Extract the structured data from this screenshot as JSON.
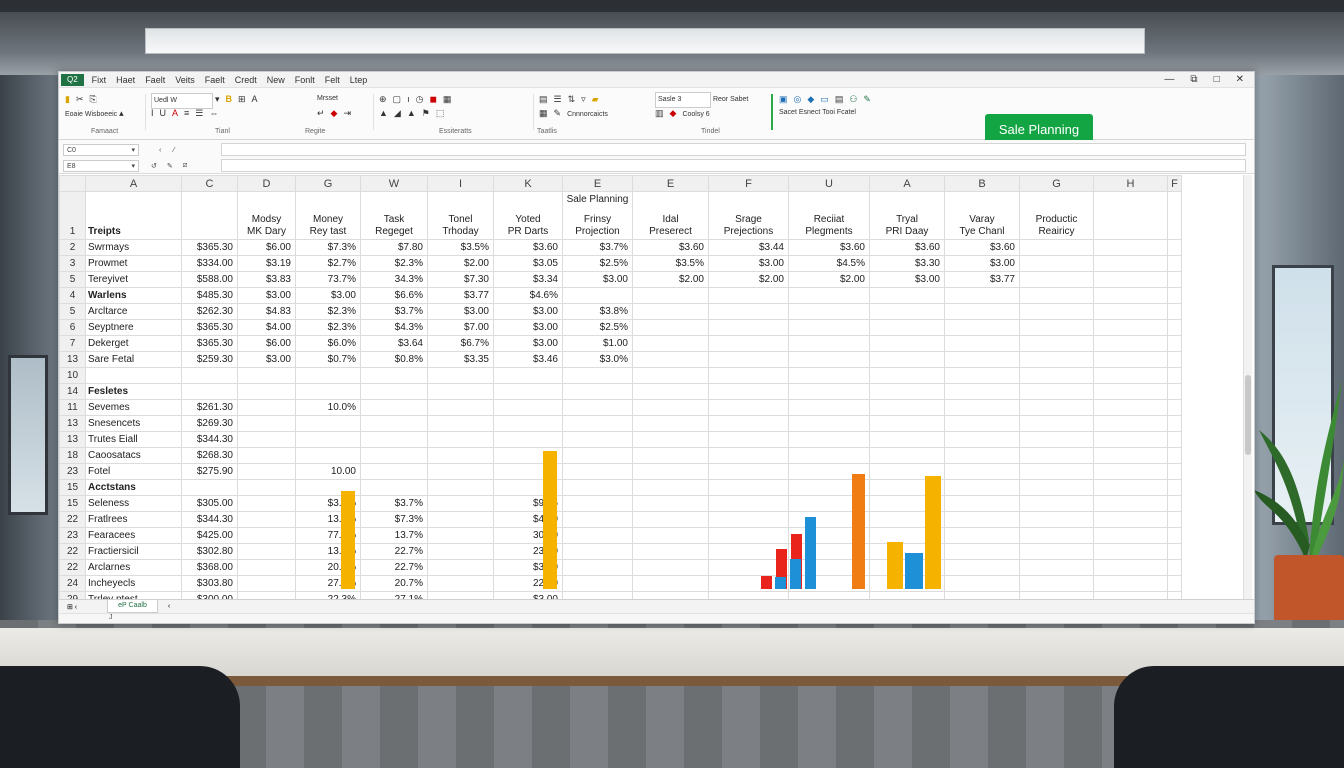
{
  "window": {
    "app_badge": "Q2",
    "menu": [
      "Fixt",
      "Haet",
      "Faelt",
      "Veits",
      "Faelt",
      "Credt",
      "New",
      "Fonlt",
      "Felt",
      "Ltep"
    ],
    "controls": [
      "—",
      "⧉",
      "□",
      "✕"
    ]
  },
  "ribbon": {
    "font_name": "Uedl W",
    "font_size": "Mrsset",
    "style_box": "Sasle 3",
    "group_labels": [
      "Famaact",
      "Tianl",
      "Regite",
      "Essiteratts",
      "Taatlis",
      "Tindel"
    ],
    "item_texts": [
      "Eoaie",
      "Wisboeeic",
      "Cnnnorcaicts",
      "Reor Sabet",
      "Coolsy 6",
      "Sacet",
      "Esnect",
      "Tooi",
      "Fcatel"
    ],
    "sale_button": "Sale Planning"
  },
  "formula_bar": {
    "name_box_1": "C0",
    "name_box_2": "E8"
  },
  "grid": {
    "columns": [
      "A",
      "C",
      "D",
      "G",
      "W",
      "I",
      "K",
      "E",
      "E",
      "F",
      "U",
      "A",
      "B",
      "G",
      "H",
      "F"
    ],
    "sheet_title": "Sale Planning",
    "headers": [
      "Treipts",
      "",
      "Modsy\nMK Dary",
      "Money\nRey tast",
      "Task\nRegeget",
      "Tonel\nTrhoday",
      "Yoted\nPR Darts",
      "Frinsy\nProjection",
      "Idal\nPreserect",
      "Srage\nPrejections",
      "Reciiat\nPlegments",
      "Tryal\nPRI Daay",
      "Varay\nTye Chanl",
      "Productic\nReairicy"
    ],
    "rows": [
      {
        "n": "2",
        "label": "Swrmays",
        "cells": [
          "$365.30",
          "$6.00",
          "$7.3%",
          "$7.80",
          "$3.5%",
          "$3.60",
          "$3.7%",
          "$3.60",
          "$3.44",
          "$3.60",
          "$3.60",
          "$3.60",
          ""
        ]
      },
      {
        "n": "3",
        "label": "Prowmet",
        "cells": [
          "$334.00",
          "$3.19",
          "$2.7%",
          "$2.3%",
          "$2.00",
          "$3.05",
          "$2.5%",
          "$3.5%",
          "$3.00",
          "$4.5%",
          "$3.30",
          "$3.00",
          ""
        ]
      },
      {
        "n": "5",
        "label": "Tereyivet",
        "cells": [
          "$588.00",
          "$3.83",
          "73.7%",
          "34.3%",
          "$7.30",
          "$3.34",
          "$3.00",
          "$2.00",
          "$2.00",
          "$2.00",
          "$3.00",
          "$3.77",
          ""
        ]
      },
      {
        "n": "4",
        "label": "Warlens",
        "section": true,
        "cells": [
          "$485.30",
          "$3.00",
          "$3.00",
          "$6.6%",
          "$3.77",
          "$4.6%",
          "",
          "",
          "",
          "",
          "",
          "",
          ""
        ]
      },
      {
        "n": "5",
        "label": "Arcltarce",
        "cells": [
          "$262.30",
          "$4.83",
          "$2.3%",
          "$3.7%",
          "$3.00",
          "$3.00",
          "$3.8%",
          "",
          "",
          "",
          "",
          "",
          ""
        ]
      },
      {
        "n": "6",
        "label": "Seyptnere",
        "cells": [
          "$365.30",
          "$4.00",
          "$2.3%",
          "$4.3%",
          "$7.00",
          "$3.00",
          "$2.5%",
          "",
          "",
          "",
          "",
          "",
          ""
        ]
      },
      {
        "n": "7",
        "label": "Dekerget",
        "cells": [
          "$365.30",
          "$6.00",
          "$6.0%",
          "$3.64",
          "$6.7%",
          "$3.00",
          "$1.00",
          "",
          "",
          "",
          "",
          "",
          ""
        ]
      },
      {
        "n": "13",
        "label": "Sare Fetal",
        "cells": [
          "$259.30",
          "$3.00",
          "$0.7%",
          "$0.8%",
          "$3.35",
          "$3.46",
          "$3.0%",
          "",
          "",
          "",
          "",
          "",
          ""
        ]
      },
      {
        "n": "10",
        "label": "",
        "cells": [
          "",
          "",
          "",
          "",
          "",
          "",
          "",
          "",
          "",
          "",
          "",
          "",
          ""
        ]
      },
      {
        "n": "14",
        "label": "Fesletes",
        "section": true,
        "cells": [
          "",
          "",
          "",
          "",
          "",
          "",
          "",
          "",
          "",
          "",
          "",
          "",
          ""
        ]
      },
      {
        "n": "11",
        "label": "Sevemes",
        "cells": [
          "$261.30",
          "",
          "10.0%",
          "",
          "",
          "",
          "",
          "",
          "",
          "",
          "",
          "",
          ""
        ]
      },
      {
        "n": "13",
        "label": "Snesencets",
        "cells": [
          "$269.30",
          "",
          "",
          "",
          "",
          "",
          "",
          "",
          "",
          "",
          "",
          "",
          ""
        ]
      },
      {
        "n": "13",
        "label": "Trutes Eiall",
        "cells": [
          "$344.30",
          "",
          "",
          "",
          "",
          "",
          "",
          "",
          "",
          "",
          "",
          "",
          ""
        ]
      },
      {
        "n": "18",
        "label": "Caoosatacs",
        "cells": [
          "$268.30",
          "",
          "",
          "",
          "",
          "",
          "",
          "",
          "",
          "",
          "",
          "",
          ""
        ]
      },
      {
        "n": "23",
        "label": "Fotel",
        "cells": [
          "$275.90",
          "",
          "10.00",
          "",
          "",
          "",
          "",
          "",
          "",
          "",
          "",
          "",
          ""
        ]
      },
      {
        "n": "15",
        "label": "Acctstans",
        "section": true,
        "cells": [
          "",
          "",
          "",
          "",
          "",
          "",
          "",
          "",
          "",
          "",
          "",
          "",
          ""
        ]
      },
      {
        "n": "15",
        "label": "Seleness",
        "cells": [
          "$305.00",
          "",
          "$3.7%",
          "$3.7%",
          "",
          "$9.36",
          "",
          "",
          "",
          "",
          "",
          "",
          ""
        ]
      },
      {
        "n": "22",
        "label": "Fratlrees",
        "cells": [
          "$344.30",
          "",
          "13.7%",
          "$7.3%",
          "",
          "$4.00",
          "",
          "",
          "",
          "",
          "",
          "",
          ""
        ]
      },
      {
        "n": "23",
        "label": "Fearacees",
        "cells": [
          "$425.00",
          "",
          "77.3%",
          "13.7%",
          "",
          "30.00",
          "",
          "",
          "",
          "",
          "",
          "",
          ""
        ]
      },
      {
        "n": "22",
        "label": "Fractiersicil",
        "cells": [
          "$302.80",
          "",
          "13.7%",
          "22.7%",
          "",
          "23.00",
          "",
          "",
          "",
          "",
          "",
          "",
          ""
        ]
      },
      {
        "n": "22",
        "label": "Arclarnes",
        "cells": [
          "$368.00",
          "",
          "20.7%",
          "22.7%",
          "",
          "$3.80",
          "",
          "",
          "",
          "",
          "",
          "",
          ""
        ]
      },
      {
        "n": "24",
        "label": "Incheyecls",
        "cells": [
          "$303.80",
          "",
          "27.7%",
          "20.7%",
          "",
          "22.00",
          "",
          "",
          "",
          "",
          "",
          "",
          ""
        ]
      },
      {
        "n": "29",
        "label": "Trrley ptest",
        "cells": [
          "$300.00",
          "",
          "22.3%",
          "27.1%",
          "",
          "$3.00",
          "",
          "",
          "",
          "",
          "",
          "",
          ""
        ]
      }
    ]
  },
  "chart_data": {
    "type": "bar",
    "series": [
      {
        "color": "#f5b300",
        "values": [
          98
        ]
      },
      {
        "color": "#f5b300",
        "values": [
          138
        ]
      },
      {
        "color": "#e8241c",
        "values": [
          13,
          40,
          55
        ]
      },
      {
        "color": "#1e90d8",
        "values": [
          12,
          30,
          72
        ]
      },
      {
        "color": "#f07d14",
        "values": [
          115
        ]
      },
      {
        "color": "#f5b300",
        "values": [
          47,
          113
        ]
      },
      {
        "color": "#1e90d8",
        "values": [
          36
        ]
      }
    ]
  },
  "sheet": {
    "tab": "Caalb",
    "tab_prefix": "eP",
    "status": "J"
  }
}
